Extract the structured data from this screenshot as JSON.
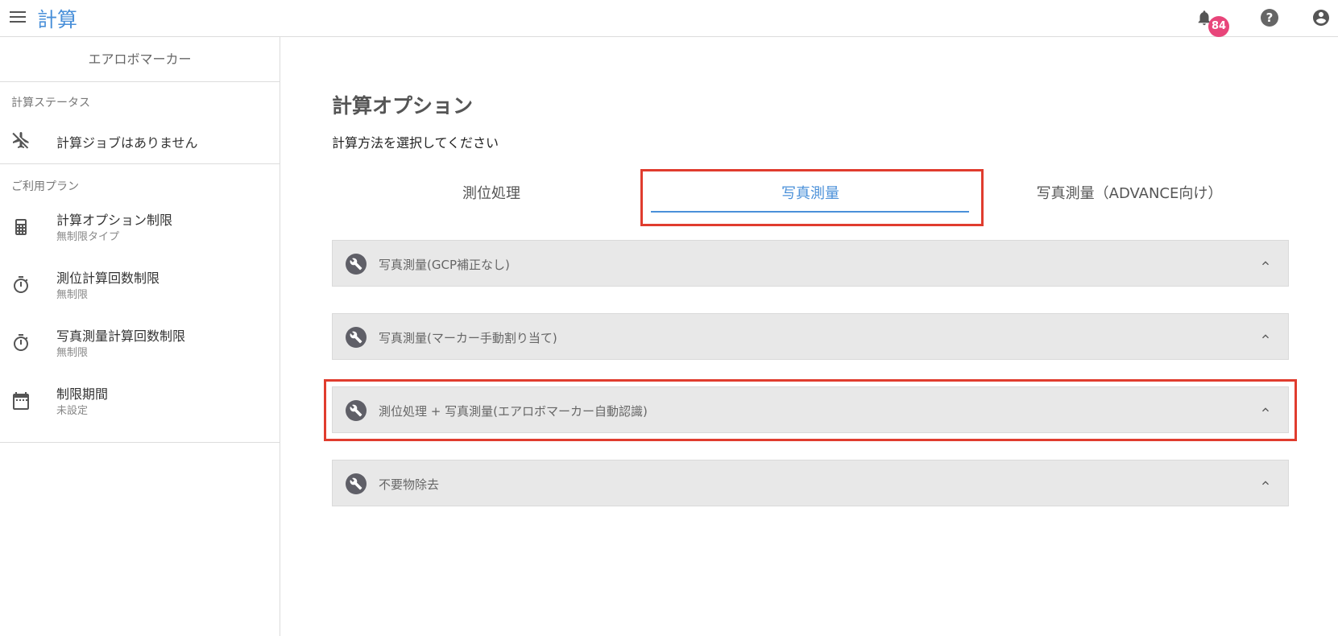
{
  "topbar": {
    "title": "計算",
    "notification_count": "84",
    "help_glyph": "?",
    "icons": [
      "menu-icon",
      "bell-icon",
      "help-icon",
      "account-circle-icon"
    ]
  },
  "sidebar": {
    "header": "エアロボマーカー",
    "status_section": "計算ステータス",
    "status_item": "計算ジョブはありません",
    "plan_section": "ご利用プラン",
    "plan_items": [
      {
        "label": "計算オプション制限",
        "value": "無制限タイプ",
        "icon": "calculator-icon"
      },
      {
        "label": "測位計算回数制限",
        "value": "無制限",
        "icon": "timer-icon"
      },
      {
        "label": "写真測量計算回数制限",
        "value": "無制限",
        "icon": "timer-icon"
      },
      {
        "label": "制限期間",
        "value": "未設定",
        "icon": "calendar-icon"
      }
    ]
  },
  "main": {
    "title": "計算オプション",
    "subtitle": "計算方法を選択してください",
    "tabs": [
      {
        "label": "測位処理",
        "active": false
      },
      {
        "label": "写真測量",
        "active": true
      },
      {
        "label": "写真測量（ADVANCE向け）",
        "active": false
      }
    ],
    "panels": [
      {
        "label": "写真測量(GCP補正なし)"
      },
      {
        "label": "写真測量(マーカー手動割り当て)"
      },
      {
        "label": "測位処理 + 写真測量(エアロボマーカー自動認識)"
      },
      {
        "label": "不要物除去"
      }
    ]
  },
  "colors": {
    "accent": "#4a90d9",
    "badge": "#e8457a",
    "highlight_box": "#e03c2e",
    "panel_bg": "#e8e8e8"
  }
}
